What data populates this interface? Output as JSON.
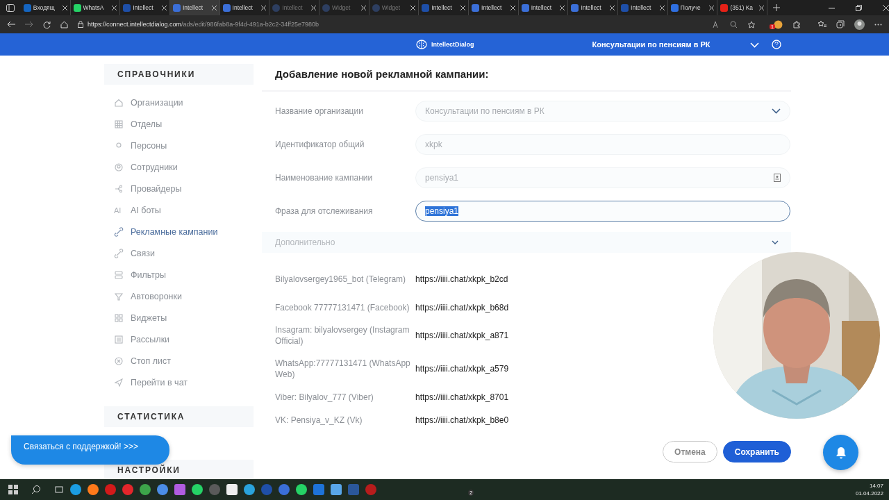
{
  "browser": {
    "tabs": [
      {
        "title": "Входящ",
        "selected": false,
        "dimmed": false,
        "color": "#1565c0"
      },
      {
        "title": "WhatsA",
        "selected": false,
        "dimmed": false,
        "color": "#25d366"
      },
      {
        "title": "Intellect",
        "selected": false,
        "dimmed": false,
        "color": "#1e4fa8"
      },
      {
        "title": "Intellect",
        "selected": true,
        "dimmed": false,
        "color": "#3b6fd8"
      },
      {
        "title": "Intellect",
        "selected": false,
        "dimmed": false,
        "color": "#3b6fd8"
      },
      {
        "title": "Intellect",
        "selected": false,
        "dimmed": true,
        "color": "#2d3e60"
      },
      {
        "title": "Widget",
        "selected": false,
        "dimmed": true,
        "color": "#2d3e60"
      },
      {
        "title": "Widget",
        "selected": false,
        "dimmed": true,
        "color": "#2d3e60"
      },
      {
        "title": "Intellect",
        "selected": false,
        "dimmed": false,
        "color": "#1e4fa8"
      },
      {
        "title": "Intellect",
        "selected": false,
        "dimmed": false,
        "color": "#3b6fd8"
      },
      {
        "title": "Intellect",
        "selected": false,
        "dimmed": false,
        "color": "#3b6fd8"
      },
      {
        "title": "Intellect",
        "selected": false,
        "dimmed": false,
        "color": "#3b6fd8"
      },
      {
        "title": "Intellect",
        "selected": false,
        "dimmed": false,
        "color": "#1e4fa8"
      },
      {
        "title": "Получе",
        "selected": false,
        "dimmed": false,
        "color": "#2f6fe0"
      },
      {
        "title": "(351) Ka",
        "selected": false,
        "dimmed": false,
        "color": "#e62117"
      }
    ],
    "url": {
      "host": "https://connect.intellectdialog.com",
      "path": "/ads/edit/986fab8a-9f4d-491a-b2c2-34ff25e7980b"
    },
    "extension_badge": "1"
  },
  "header": {
    "logo": "IntellectDialog",
    "organization": "Консультации по пенсиям в РК"
  },
  "sidebar": {
    "sections": [
      {
        "title": "СПРАВОЧНИКИ",
        "items": [
          {
            "label": "Организации",
            "selected": false
          },
          {
            "label": "Отделы",
            "selected": false
          },
          {
            "label": "Персоны",
            "selected": false
          },
          {
            "label": "Сотрудники",
            "selected": false
          },
          {
            "label": "Провайдеры",
            "selected": false
          },
          {
            "label": "AI боты",
            "selected": false,
            "icon_text": "AI"
          },
          {
            "label": "Рекламные кампании",
            "selected": true
          },
          {
            "label": "Связи",
            "selected": false
          },
          {
            "label": "Фильтры",
            "selected": false
          },
          {
            "label": "Автоворонки",
            "selected": false
          },
          {
            "label": "Виджеты",
            "selected": false
          },
          {
            "label": "Рассылки",
            "selected": false
          },
          {
            "label": "Стоп лист",
            "selected": false
          },
          {
            "label": "Перейти в чат",
            "selected": false
          }
        ]
      },
      {
        "title": "СТАТИСТИКА"
      },
      {
        "title": "НАСТРОЙКИ"
      }
    ]
  },
  "form": {
    "title": "Добавление новой рекламной кампании:",
    "fields": [
      {
        "label": "Название организации",
        "value": "Консультации по пенсиям в РК",
        "kind": "select",
        "focused": false
      },
      {
        "label": "Идентификатор общий",
        "value": "xkpk",
        "kind": "text",
        "focused": false
      },
      {
        "label": "Наименование кампании",
        "value": "pensiya1",
        "kind": "text-icon",
        "focused": false
      },
      {
        "label": "Фраза для отслеживания",
        "value": "pensiya1",
        "kind": "text",
        "focused": true
      }
    ],
    "more": {
      "label": "Дополнительно",
      "expanded": false
    },
    "links": [
      {
        "source": "Bilyalovsergey1965_bot (Telegram)",
        "url": "https://iiii.chat/xkpk_b2cd"
      },
      {
        "source": "Facebook 77777131471 (Facebook)",
        "url": "https://iiii.chat/xkpk_b68d"
      },
      {
        "source": "Insagram: bilyalovsergey (Instagram Official)",
        "url": "https://iiii.chat/xkpk_a871"
      },
      {
        "source": "WhatsApp:77777131471 (WhatsApp Web)",
        "url": "https://iiii.chat/xkpk_a579"
      },
      {
        "source": "Viber: Bilyalov_777 (Viber)",
        "url": "https://iiii.chat/xkpk_8701"
      },
      {
        "source": "VK: Pensiya_v_KZ (Vk)",
        "url": "https://iiii.chat/xkpk_b8e0"
      }
    ],
    "buttons": {
      "cancel": "Отмена",
      "save": "Сохранить"
    }
  },
  "support_button": "Связаться с поддержкой! >>>",
  "taskbar": {
    "time": "14:07",
    "date": "01.04.2022",
    "badge": "2"
  }
}
